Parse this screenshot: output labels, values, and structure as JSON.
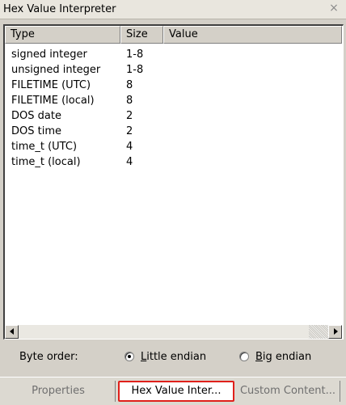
{
  "window": {
    "title": "Hex Value Interpreter",
    "close_glyph": "×"
  },
  "table": {
    "columns": [
      "Type",
      "Size",
      "Value"
    ],
    "rows": [
      {
        "type": "signed integer",
        "size": "1-8",
        "value": ""
      },
      {
        "type": "unsigned integer",
        "size": "1-8",
        "value": ""
      },
      {
        "type": "FILETIME (UTC)",
        "size": "8",
        "value": ""
      },
      {
        "type": "FILETIME (local)",
        "size": "8",
        "value": ""
      },
      {
        "type": "DOS date",
        "size": "2",
        "value": ""
      },
      {
        "type": "DOS time",
        "size": "2",
        "value": ""
      },
      {
        "type": "time_t (UTC)",
        "size": "4",
        "value": ""
      },
      {
        "type": "time_t (local)",
        "size": "4",
        "value": ""
      }
    ]
  },
  "byte_order": {
    "label": "Byte order:",
    "options": [
      {
        "label": "Little endian",
        "checked": true
      },
      {
        "label": "Big endian",
        "checked": false
      }
    ]
  },
  "tabs": [
    {
      "label": "Properties",
      "active": false
    },
    {
      "label": "Hex Value Inter...",
      "active": true
    },
    {
      "label": "Custom Content...",
      "active": false
    }
  ],
  "colors": {
    "accent_highlight": "#e0201a",
    "panel_bg": "#d4d0c8"
  }
}
